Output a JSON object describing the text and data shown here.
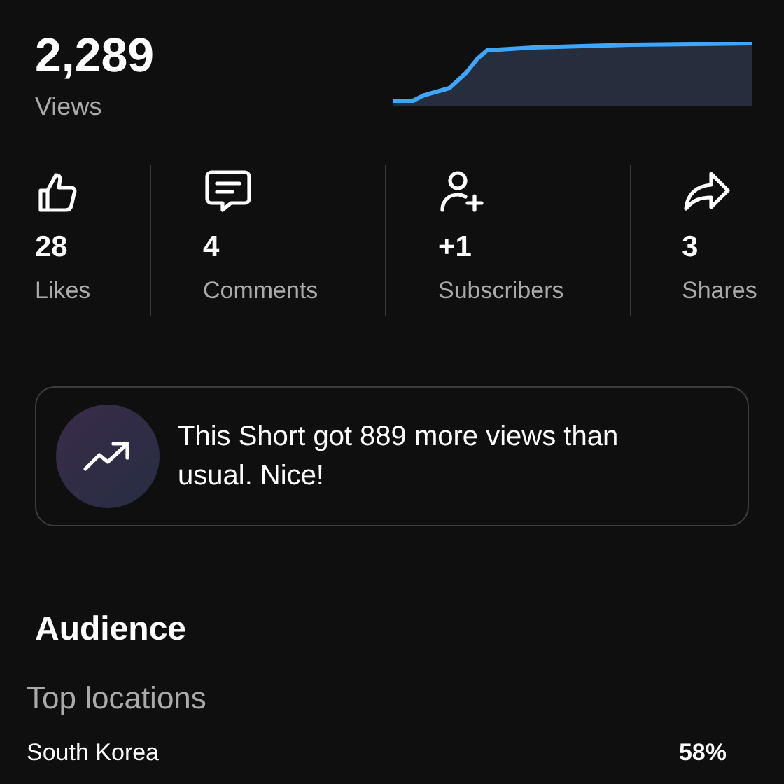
{
  "views": {
    "value": "2,289",
    "label": "Views"
  },
  "stats": [
    {
      "kind": "likes",
      "value": "28",
      "label": "Likes"
    },
    {
      "kind": "comments",
      "value": "4",
      "label": "Comments"
    },
    {
      "kind": "subscribers",
      "value": "+1",
      "label": "Subscribers"
    },
    {
      "kind": "shares",
      "value": "3",
      "label": "Shares"
    }
  ],
  "insight": {
    "text": "This Short got 889 more views than usual. Nice!"
  },
  "audience": {
    "title": "Audience",
    "subtitle": "Top locations",
    "locations": [
      {
        "name": "South Korea",
        "share": "58%"
      }
    ]
  }
}
